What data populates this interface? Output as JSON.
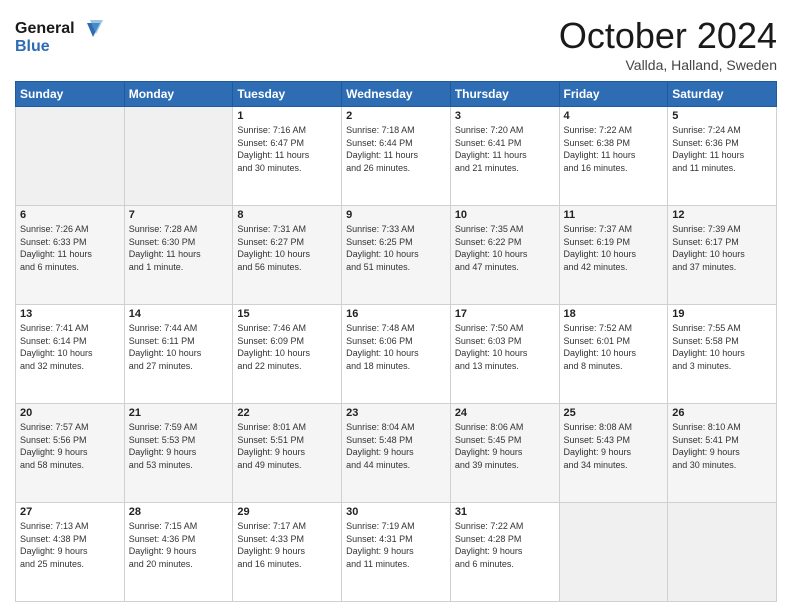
{
  "header": {
    "logo_line1": "General",
    "logo_line2": "Blue",
    "month": "October 2024",
    "location": "Vallda, Halland, Sweden"
  },
  "days_of_week": [
    "Sunday",
    "Monday",
    "Tuesday",
    "Wednesday",
    "Thursday",
    "Friday",
    "Saturday"
  ],
  "weeks": [
    [
      {
        "day": "",
        "info": ""
      },
      {
        "day": "",
        "info": ""
      },
      {
        "day": "1",
        "info": "Sunrise: 7:16 AM\nSunset: 6:47 PM\nDaylight: 11 hours\nand 30 minutes."
      },
      {
        "day": "2",
        "info": "Sunrise: 7:18 AM\nSunset: 6:44 PM\nDaylight: 11 hours\nand 26 minutes."
      },
      {
        "day": "3",
        "info": "Sunrise: 7:20 AM\nSunset: 6:41 PM\nDaylight: 11 hours\nand 21 minutes."
      },
      {
        "day": "4",
        "info": "Sunrise: 7:22 AM\nSunset: 6:38 PM\nDaylight: 11 hours\nand 16 minutes."
      },
      {
        "day": "5",
        "info": "Sunrise: 7:24 AM\nSunset: 6:36 PM\nDaylight: 11 hours\nand 11 minutes."
      }
    ],
    [
      {
        "day": "6",
        "info": "Sunrise: 7:26 AM\nSunset: 6:33 PM\nDaylight: 11 hours\nand 6 minutes."
      },
      {
        "day": "7",
        "info": "Sunrise: 7:28 AM\nSunset: 6:30 PM\nDaylight: 11 hours\nand 1 minute."
      },
      {
        "day": "8",
        "info": "Sunrise: 7:31 AM\nSunset: 6:27 PM\nDaylight: 10 hours\nand 56 minutes."
      },
      {
        "day": "9",
        "info": "Sunrise: 7:33 AM\nSunset: 6:25 PM\nDaylight: 10 hours\nand 51 minutes."
      },
      {
        "day": "10",
        "info": "Sunrise: 7:35 AM\nSunset: 6:22 PM\nDaylight: 10 hours\nand 47 minutes."
      },
      {
        "day": "11",
        "info": "Sunrise: 7:37 AM\nSunset: 6:19 PM\nDaylight: 10 hours\nand 42 minutes."
      },
      {
        "day": "12",
        "info": "Sunrise: 7:39 AM\nSunset: 6:17 PM\nDaylight: 10 hours\nand 37 minutes."
      }
    ],
    [
      {
        "day": "13",
        "info": "Sunrise: 7:41 AM\nSunset: 6:14 PM\nDaylight: 10 hours\nand 32 minutes."
      },
      {
        "day": "14",
        "info": "Sunrise: 7:44 AM\nSunset: 6:11 PM\nDaylight: 10 hours\nand 27 minutes."
      },
      {
        "day": "15",
        "info": "Sunrise: 7:46 AM\nSunset: 6:09 PM\nDaylight: 10 hours\nand 22 minutes."
      },
      {
        "day": "16",
        "info": "Sunrise: 7:48 AM\nSunset: 6:06 PM\nDaylight: 10 hours\nand 18 minutes."
      },
      {
        "day": "17",
        "info": "Sunrise: 7:50 AM\nSunset: 6:03 PM\nDaylight: 10 hours\nand 13 minutes."
      },
      {
        "day": "18",
        "info": "Sunrise: 7:52 AM\nSunset: 6:01 PM\nDaylight: 10 hours\nand 8 minutes."
      },
      {
        "day": "19",
        "info": "Sunrise: 7:55 AM\nSunset: 5:58 PM\nDaylight: 10 hours\nand 3 minutes."
      }
    ],
    [
      {
        "day": "20",
        "info": "Sunrise: 7:57 AM\nSunset: 5:56 PM\nDaylight: 9 hours\nand 58 minutes."
      },
      {
        "day": "21",
        "info": "Sunrise: 7:59 AM\nSunset: 5:53 PM\nDaylight: 9 hours\nand 53 minutes."
      },
      {
        "day": "22",
        "info": "Sunrise: 8:01 AM\nSunset: 5:51 PM\nDaylight: 9 hours\nand 49 minutes."
      },
      {
        "day": "23",
        "info": "Sunrise: 8:04 AM\nSunset: 5:48 PM\nDaylight: 9 hours\nand 44 minutes."
      },
      {
        "day": "24",
        "info": "Sunrise: 8:06 AM\nSunset: 5:45 PM\nDaylight: 9 hours\nand 39 minutes."
      },
      {
        "day": "25",
        "info": "Sunrise: 8:08 AM\nSunset: 5:43 PM\nDaylight: 9 hours\nand 34 minutes."
      },
      {
        "day": "26",
        "info": "Sunrise: 8:10 AM\nSunset: 5:41 PM\nDaylight: 9 hours\nand 30 minutes."
      }
    ],
    [
      {
        "day": "27",
        "info": "Sunrise: 7:13 AM\nSunset: 4:38 PM\nDaylight: 9 hours\nand 25 minutes."
      },
      {
        "day": "28",
        "info": "Sunrise: 7:15 AM\nSunset: 4:36 PM\nDaylight: 9 hours\nand 20 minutes."
      },
      {
        "day": "29",
        "info": "Sunrise: 7:17 AM\nSunset: 4:33 PM\nDaylight: 9 hours\nand 16 minutes."
      },
      {
        "day": "30",
        "info": "Sunrise: 7:19 AM\nSunset: 4:31 PM\nDaylight: 9 hours\nand 11 minutes."
      },
      {
        "day": "31",
        "info": "Sunrise: 7:22 AM\nSunset: 4:28 PM\nDaylight: 9 hours\nand 6 minutes."
      },
      {
        "day": "",
        "info": ""
      },
      {
        "day": "",
        "info": ""
      }
    ]
  ]
}
